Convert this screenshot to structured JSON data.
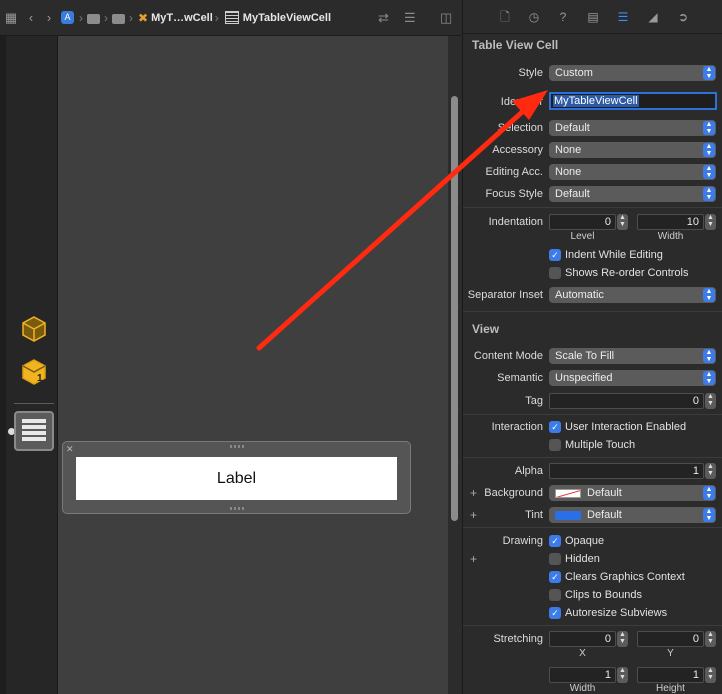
{
  "jumpbar": {
    "file_short": "MyT…wCell",
    "selected": "MyTableViewCell",
    "icons": [
      "grid-icon",
      "back-chevron-icon",
      "forward-chevron-icon",
      "app-icon",
      "folder-icon",
      "xib-icon",
      "table-cell-icon",
      "swap-icon",
      "list-icon",
      "split-editor-icon"
    ]
  },
  "canvas": {
    "cell_label": "Label"
  },
  "inspector": {
    "tab_icons": [
      "file-icon",
      "history-icon",
      "help-icon",
      "identity-icon",
      "attributes-icon",
      "size-icon",
      "connections-icon"
    ],
    "active_tab": "attributes-icon",
    "table_view_cell": {
      "title": "Table View Cell",
      "style_label": "Style",
      "style_value": "Custom",
      "identifier_label": "Identifier",
      "identifier_value": "MyTableViewCell",
      "selection_label": "Selection",
      "selection_value": "Default",
      "accessory_label": "Accessory",
      "accessory_value": "None",
      "editing_acc_label": "Editing Acc.",
      "editing_acc_value": "None",
      "focus_style_label": "Focus Style",
      "focus_style_value": "Default",
      "indentation_label": "Indentation",
      "level_value": "0",
      "level_label": "Level",
      "width_value": "10",
      "width_label": "Width",
      "indent_while_editing_label": "Indent While Editing",
      "indent_while_editing": true,
      "shows_reorder_label": "Shows Re-order Controls",
      "shows_reorder": false,
      "separator_inset_label": "Separator Inset",
      "separator_inset_value": "Automatic"
    },
    "view": {
      "title": "View",
      "content_mode_label": "Content Mode",
      "content_mode_value": "Scale To Fill",
      "semantic_label": "Semantic",
      "semantic_value": "Unspecified",
      "tag_label": "Tag",
      "tag_value": "0",
      "interaction_label": "Interaction",
      "user_interaction_label": "User Interaction Enabled",
      "user_interaction": true,
      "multiple_touch_label": "Multiple Touch",
      "multiple_touch": false,
      "alpha_label": "Alpha",
      "alpha_value": "1",
      "background_label": "Background",
      "background_value": "Default",
      "tint_label": "Tint",
      "tint_value": "Default",
      "drawing_label": "Drawing",
      "opaque_label": "Opaque",
      "opaque": true,
      "hidden_label": "Hidden",
      "hidden": false,
      "clears_label": "Clears Graphics Context",
      "clears": true,
      "clips_label": "Clips to Bounds",
      "clips": false,
      "autoresize_label": "Autoresize Subviews",
      "autoresize": true,
      "stretching_label": "Stretching",
      "stretch_x": "0",
      "stretch_y": "0",
      "x_label": "X",
      "y_label": "Y",
      "stretch_w": "1",
      "stretch_h": "1",
      "width_label": "Width",
      "height_label": "Height"
    },
    "plus": "+"
  },
  "colors": {
    "accent": "#3d7ce8",
    "annotation_arrow": "#ff2a10"
  }
}
